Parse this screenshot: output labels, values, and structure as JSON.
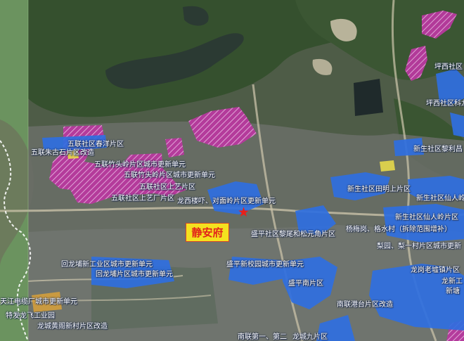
{
  "map": {
    "target_label": "静安府",
    "marker_icon": "red-star-icon",
    "colors": {
      "renewal_zone": "#2f6fe0",
      "industrial_zone": "#b8389e",
      "target_box": "#f4e11f",
      "target_text": "#e2231a"
    },
    "labels": [
      "五联社区春洋片区",
      "五联朱古石片区改造",
      "五联竹头岭片区城市更新单元",
      "五联竹头岭片区城市更新单元",
      "五联社区上艺片区",
      "五联社区上艺厂片区",
      "龙西楼吓、对面岭片区更新单元",
      "坪西社区",
      "坪西社区科龙工业区",
      "新生社区黎利昌",
      "新生社区田明上片区",
      "新生社区仙人岭片",
      "新生社区仙人岭片区",
      "盛平社区黎尾和松元角片区",
      "杨梅岗、格水村（拆除范围增补）",
      "梨园、梨一村片区城市更新",
      "回龙埔新工业区城市更新单元",
      "回龙埔片区城市更新单元",
      "盛平新校园城市更新单元",
      "盛平南片区",
      "龙岗老墟镇片区",
      "龙新工",
      "新塘",
      "南联港台片区改造",
      "天江电缆厂城市更新单元",
      "特发龙飞工业园",
      "龙城黄阁新村片区改造",
      "南联第一、第二",
      "龙城九片区"
    ]
  }
}
